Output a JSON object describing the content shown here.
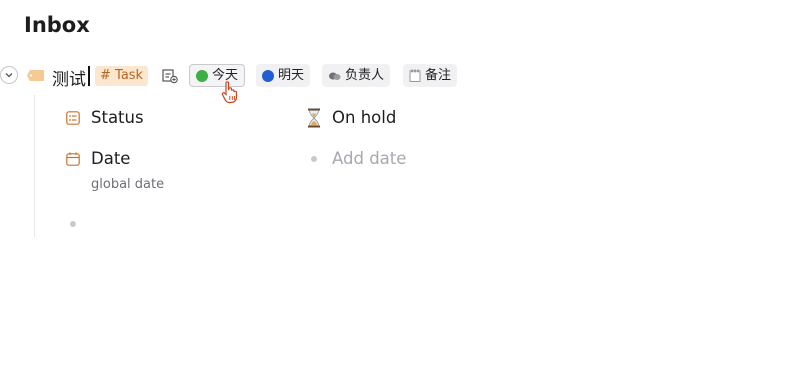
{
  "header": {
    "title": "Inbox"
  },
  "node": {
    "text": "测试",
    "tag": "# Task",
    "chips": [
      {
        "label": "今天",
        "color": "#3cb043"
      },
      {
        "label": "明天",
        "color": "#1f5fd0"
      },
      {
        "label": "负责人"
      },
      {
        "label": "备注"
      }
    ]
  },
  "fields": {
    "status": {
      "label": "Status",
      "value": "On hold"
    },
    "date": {
      "label": "Date",
      "description": "global date",
      "placeholder": "Add date"
    }
  },
  "colors": {
    "accent_orange": "#c9722a",
    "tag_bg": "#fbe7cf"
  }
}
